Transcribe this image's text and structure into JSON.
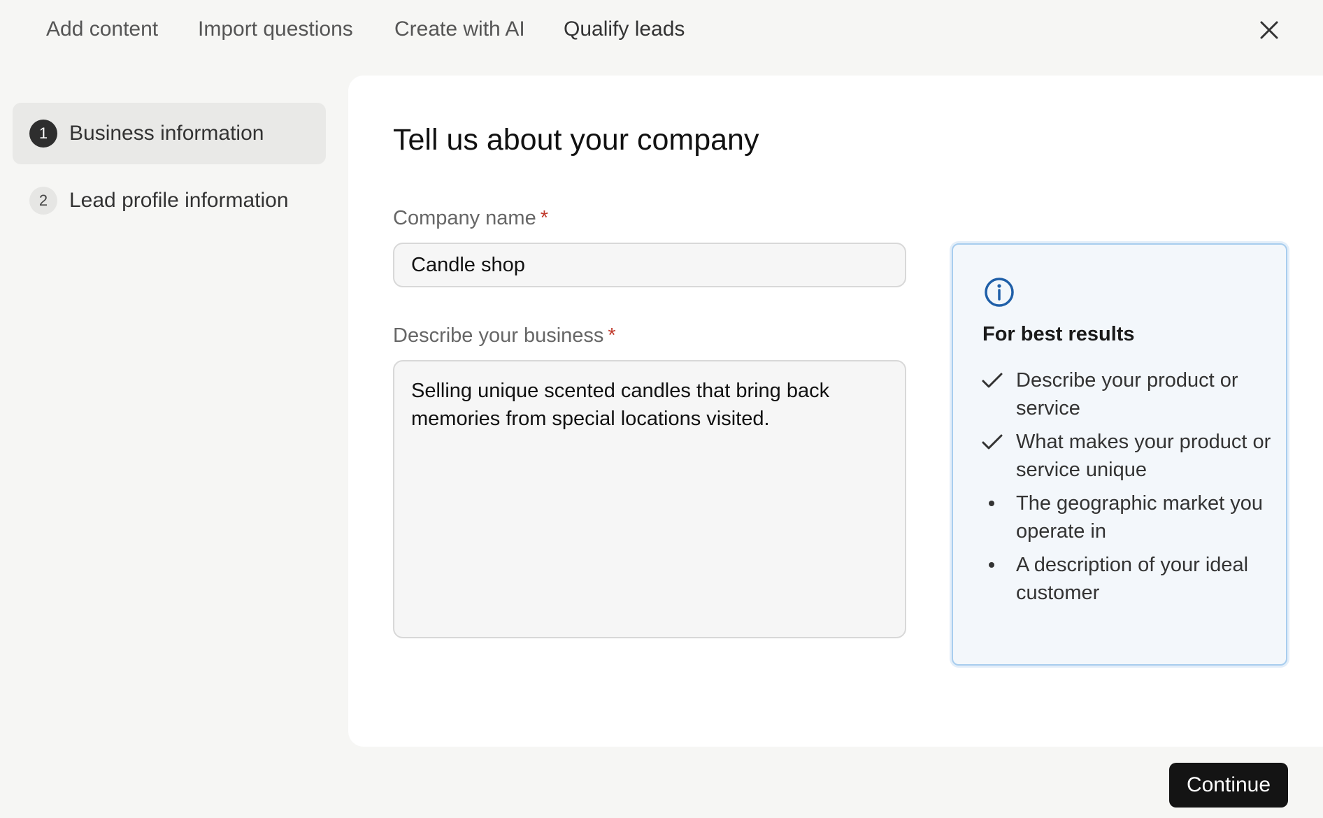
{
  "tabs": [
    {
      "label": "Add content"
    },
    {
      "label": "Import questions"
    },
    {
      "label": "Create with AI"
    },
    {
      "label": "Qualify leads",
      "active": true
    }
  ],
  "steps": [
    {
      "number": "1",
      "label": "Business information",
      "active": true
    },
    {
      "number": "2",
      "label": "Lead profile information",
      "active": false
    }
  ],
  "form": {
    "title": "Tell us about your company",
    "company_name": {
      "label": "Company name",
      "required_mark": "*",
      "value": "Candle shop"
    },
    "description": {
      "label": "Describe your business",
      "required_mark": "*",
      "value": "Selling unique scented candles that bring back memories from special locations visited."
    }
  },
  "tips": {
    "icon": "info-icon",
    "heading": "For best results",
    "items": [
      {
        "text": "Describe your product or service",
        "status": "checked"
      },
      {
        "text": "What makes your product or service unique",
        "status": "checked"
      },
      {
        "text": "The geographic market you operate in",
        "status": "bullet"
      },
      {
        "text": "A description of your ideal customer",
        "status": "bullet"
      }
    ]
  },
  "actions": {
    "continue_label": "Continue"
  },
  "colors": {
    "accent_info": "#1f5fa8",
    "required": "#c0392b",
    "primary_button": "#141414"
  }
}
